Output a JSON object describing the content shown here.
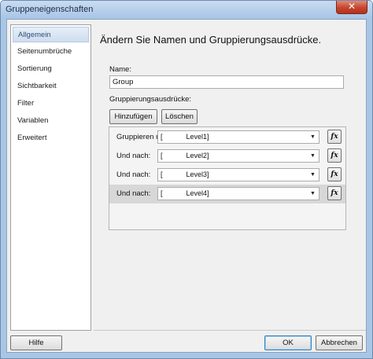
{
  "window": {
    "title": "Gruppeneigenschaften",
    "close_label": "✕"
  },
  "nav": {
    "items": [
      {
        "label": "Allgemein",
        "selected": true
      },
      {
        "label": "Seitenumbrüche",
        "selected": false
      },
      {
        "label": "Sortierung",
        "selected": false
      },
      {
        "label": "Sichtbarkeit",
        "selected": false
      },
      {
        "label": "Filter",
        "selected": false
      },
      {
        "label": "Variablen",
        "selected": false
      },
      {
        "label": "Erweitert",
        "selected": false
      }
    ]
  },
  "main": {
    "heading": "Ändern Sie Namen und Gruppierungsausdrücke.",
    "name_label": "Name:",
    "name_value": "Group",
    "expressions_label": "Gruppierungsausdrücke:",
    "add_button": "Hinzufügen",
    "delete_button": "Löschen",
    "rows": [
      {
        "label": "Gruppieren nach:",
        "value": "[            Level1]"
      },
      {
        "label": "Und nach:",
        "value": "[            Level2]"
      },
      {
        "label": "Und nach:",
        "value": "[            Level3]"
      },
      {
        "label": "Und nach:",
        "value": "[            Level4]"
      }
    ],
    "fx_label": "fx",
    "dropdown_arrow": "▼"
  },
  "footer": {
    "help_button": "Hilfe",
    "ok_button": "OK",
    "cancel_button": "Abbrechen"
  }
}
